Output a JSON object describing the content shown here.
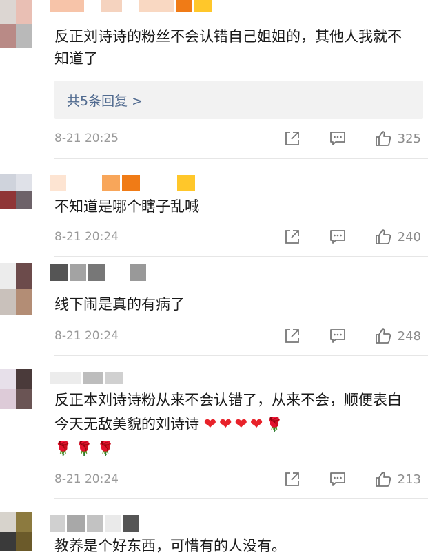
{
  "comments": [
    {
      "text": "反正刘诗诗的粉丝不会认错自己姐姐的，其他人我就不知道了",
      "replies": "共5条回复 >",
      "time": "8-21 20:25",
      "likes": "325"
    },
    {
      "text": "不知道是哪个瞎子乱喊",
      "time": "8-21 20:24",
      "likes": "240"
    },
    {
      "text": "线下闹是真的有病了",
      "time": "8-21 20:24",
      "likes": "248"
    },
    {
      "text": "反正本刘诗诗粉从来不会认错了，从来不会，顺便表白今天无敌美貌的刘诗诗",
      "emoji_hearts": [
        "❤",
        "❤",
        "❤",
        "❤"
      ],
      "emoji_roses": [
        "🌹",
        "🌹",
        "🌹",
        "🌹"
      ],
      "time": "8-21 20:24",
      "likes": "213"
    },
    {
      "text": "教养是个好东西，可惜有的人没有。"
    }
  ],
  "icons": [
    "share-icon",
    "comment-icon",
    "like-icon"
  ],
  "colors": {
    "reply_link": "#506a8f",
    "meta_text": "#9a9a9a",
    "reply_bg": "#f2f2f2",
    "heart": "#e8222a"
  }
}
